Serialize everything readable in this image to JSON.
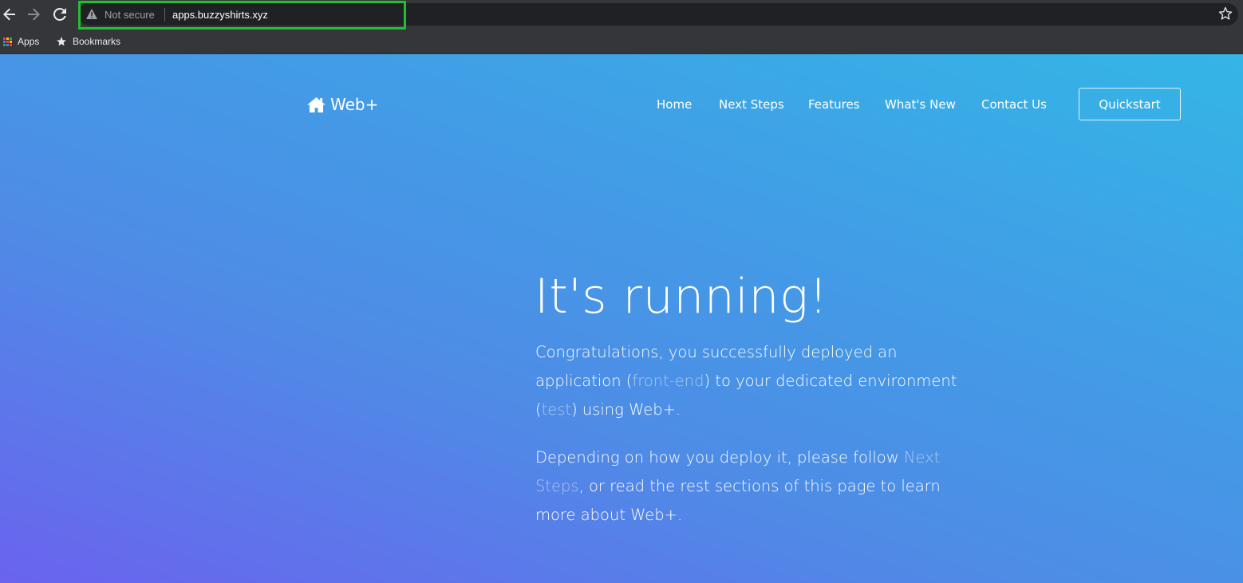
{
  "browser": {
    "security_label": "Not secure",
    "url": "apps.buzzyshirts.xyz",
    "bookmarks": [
      {
        "label": "Apps"
      },
      {
        "label": "Bookmarks"
      }
    ],
    "highlight_color": "#1fc12c"
  },
  "site": {
    "brand": "Web+",
    "nav": {
      "home": "Home",
      "next_steps": "Next Steps",
      "features": "Features",
      "whats_new": "What's New",
      "contact": "Contact Us"
    },
    "cta": "Quickstart"
  },
  "hero": {
    "title": "It's running!",
    "para1": {
      "t1": "Congratulations, you successfully deployed an application (",
      "app": "front-end",
      "t2": ") to your dedicated environment (",
      "env": "test",
      "t3": ") using Web+."
    },
    "para2": {
      "t1": "Depending on how you deploy it, please follow ",
      "link": "Next Steps",
      "t2": ", or read the rest sections of this page to learn more about Web+."
    }
  }
}
